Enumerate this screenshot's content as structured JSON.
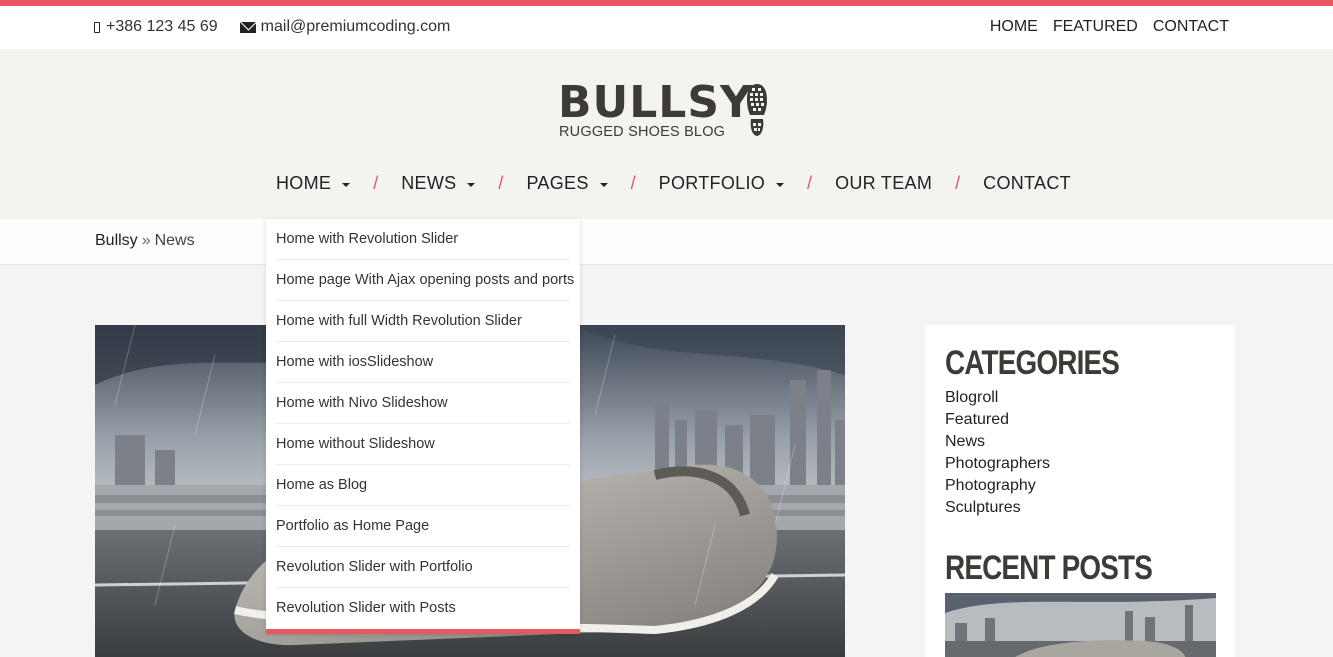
{
  "colors": {
    "accent": "#e5585f",
    "header_bg": "#f3f3ef",
    "body_bg": "#f4f4f4",
    "logo": "#3e3a36"
  },
  "topbar": {
    "phone": "+386 123 45 69",
    "email": "mail@premiumcoding.com",
    "nav": [
      "HOME",
      "FEATURED",
      "CONTACT"
    ]
  },
  "logo": {
    "name": "BULLSY",
    "tagline": "RUGGED SHOES BLOG",
    "icon": "boot-print-icon"
  },
  "main_nav": [
    {
      "label": "HOME",
      "has_dropdown": true
    },
    {
      "label": "NEWS",
      "has_dropdown": true
    },
    {
      "label": "PAGES",
      "has_dropdown": true
    },
    {
      "label": "PORTFOLIO",
      "has_dropdown": true
    },
    {
      "label": "OUR TEAM",
      "has_dropdown": false
    },
    {
      "label": "CONTACT",
      "has_dropdown": false
    }
  ],
  "nav_separator": "/",
  "breadcrumb": {
    "root": "Bullsy",
    "separator": "»",
    "current": "News"
  },
  "dropdown": {
    "items": [
      "Home with Revolution Slider",
      "Home page With Ajax opening posts and ports",
      "Home with full Width Revolution Slider",
      "Home with iosSlideshow",
      "Home with Nivo Slideshow",
      "Home without Slideshow",
      "Home as Blog",
      "Portfolio as Home Page",
      "Revolution Slider with Portfolio",
      "Revolution Slider with Posts"
    ]
  },
  "sidebar": {
    "categories_title": "CATEGORIES",
    "categories": [
      "Blogroll",
      "Featured",
      "News",
      "Photographers",
      "Photography",
      "Sculptures"
    ],
    "recent_posts_title": "RECENT POSTS"
  }
}
